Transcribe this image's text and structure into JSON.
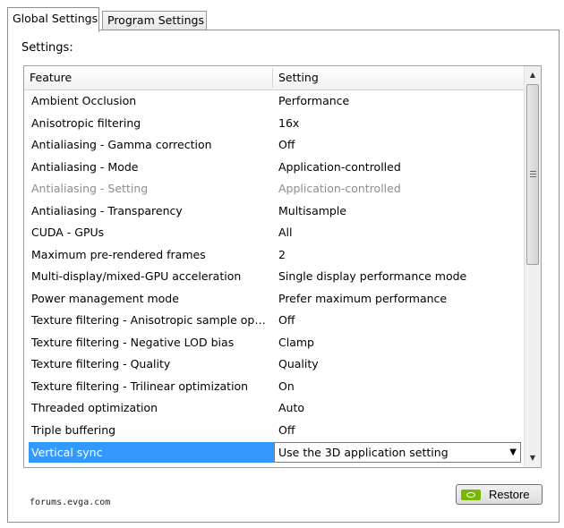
{
  "tabs": [
    {
      "label": "Global Settings",
      "active": true
    },
    {
      "label": "Program Settings",
      "active": false
    }
  ],
  "settings_label": "Settings:",
  "grid": {
    "headers": {
      "feature": "Feature",
      "setting": "Setting"
    },
    "rows": [
      {
        "feature": "Ambient Occlusion",
        "setting": "Performance"
      },
      {
        "feature": "Anisotropic filtering",
        "setting": "16x"
      },
      {
        "feature": "Antialiasing - Gamma correction",
        "setting": "Off"
      },
      {
        "feature": "Antialiasing - Mode",
        "setting": "Application-controlled"
      },
      {
        "feature": "Antialiasing - Setting",
        "setting": "Application-controlled",
        "disabled": true
      },
      {
        "feature": "Antialiasing - Transparency",
        "setting": "Multisample"
      },
      {
        "feature": "CUDA - GPUs",
        "setting": "All"
      },
      {
        "feature": "Maximum pre-rendered frames",
        "setting": "2"
      },
      {
        "feature": "Multi-display/mixed-GPU acceleration",
        "setting": "Single display performance mode"
      },
      {
        "feature": "Power management mode",
        "setting": "Prefer maximum performance"
      },
      {
        "feature": "Texture filtering - Anisotropic sample opti…",
        "setting": "Off"
      },
      {
        "feature": "Texture filtering - Negative LOD bias",
        "setting": "Clamp"
      },
      {
        "feature": "Texture filtering - Quality",
        "setting": "Quality"
      },
      {
        "feature": "Texture filtering - Trilinear optimization",
        "setting": "On"
      },
      {
        "feature": "Threaded optimization",
        "setting": "Auto"
      },
      {
        "feature": "Triple buffering",
        "setting": "Off"
      },
      {
        "feature": "Vertical sync",
        "setting": "Use the 3D application setting",
        "selected": true
      }
    ]
  },
  "restore_button": {
    "label": "Restore",
    "icon": "nvidia-logo-icon"
  },
  "watermark": "forums.evga.com",
  "colors": {
    "selection": "#3399ff",
    "nvidia_green": "#76b900"
  }
}
